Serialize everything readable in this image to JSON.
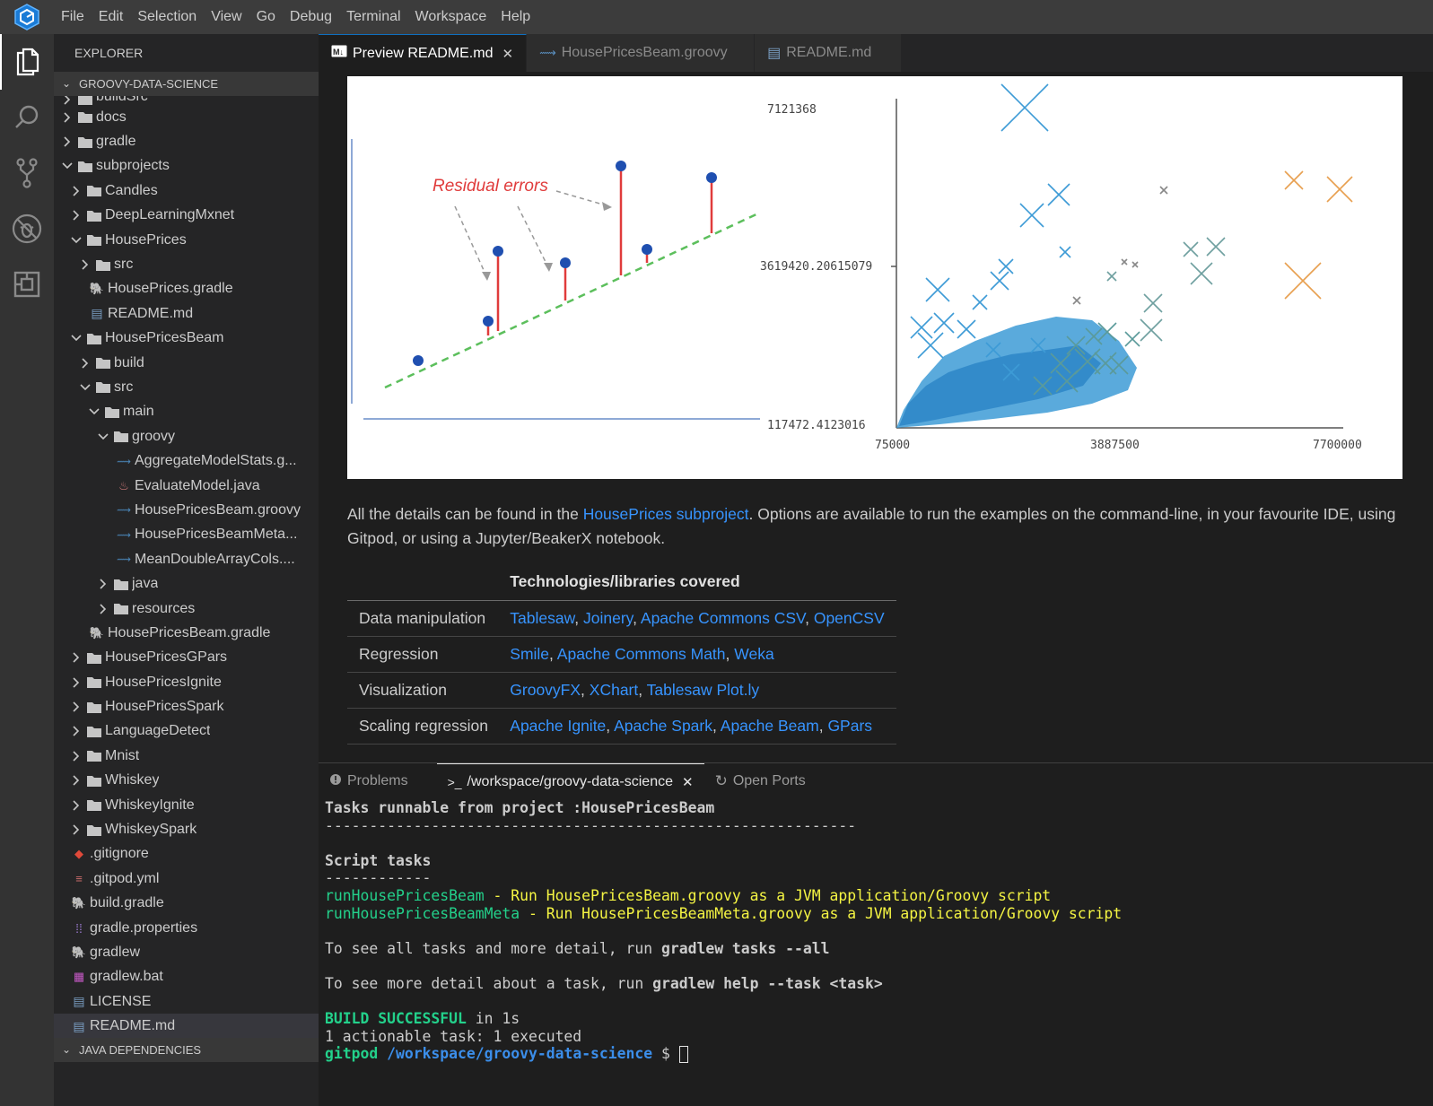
{
  "menubar": {
    "items": [
      "File",
      "Edit",
      "Selection",
      "View",
      "Go",
      "Debug",
      "Terminal",
      "Workspace",
      "Help"
    ]
  },
  "activity_bar": {
    "icons": [
      "files-icon",
      "search-icon",
      "source-control-icon",
      "debug-icon",
      "extensions-icon"
    ]
  },
  "sidebar": {
    "title": "EXPLORER",
    "project_section": "GROOVY-DATA-SCIENCE",
    "dependencies_section": "JAVA DEPENDENCIES",
    "tree": [
      {
        "label": "buildSrc",
        "depth": 0,
        "type": "folder",
        "state": "closed"
      },
      {
        "label": "docs",
        "depth": 0,
        "type": "folder",
        "state": "closed"
      },
      {
        "label": "gradle",
        "depth": 0,
        "type": "folder",
        "state": "closed"
      },
      {
        "label": "subprojects",
        "depth": 0,
        "type": "folder",
        "state": "open"
      },
      {
        "label": "Candles",
        "depth": 1,
        "type": "folder",
        "state": "closed"
      },
      {
        "label": "DeepLearningMxnet",
        "depth": 1,
        "type": "folder",
        "state": "closed"
      },
      {
        "label": "HousePrices",
        "depth": 1,
        "type": "folder",
        "state": "open"
      },
      {
        "label": "src",
        "depth": 2,
        "type": "folder",
        "state": "closed"
      },
      {
        "label": "HousePrices.gradle",
        "depth": 2,
        "type": "gradle"
      },
      {
        "label": "README.md",
        "depth": 2,
        "type": "md"
      },
      {
        "label": "HousePricesBeam",
        "depth": 1,
        "type": "folder",
        "state": "open"
      },
      {
        "label": "build",
        "depth": 2,
        "type": "folder",
        "state": "closed"
      },
      {
        "label": "src",
        "depth": 2,
        "type": "folder",
        "state": "open"
      },
      {
        "label": "main",
        "depth": 3,
        "type": "folder",
        "state": "open"
      },
      {
        "label": "groovy",
        "depth": 4,
        "type": "folder",
        "state": "open"
      },
      {
        "label": "AggregateModelStats.g...",
        "depth": 5,
        "type": "groovy"
      },
      {
        "label": "EvaluateModel.java",
        "depth": 5,
        "type": "java"
      },
      {
        "label": "HousePricesBeam.groovy",
        "depth": 5,
        "type": "groovy"
      },
      {
        "label": "HousePricesBeamMeta...",
        "depth": 5,
        "type": "groovy"
      },
      {
        "label": "MeanDoubleArrayCols....",
        "depth": 5,
        "type": "groovy"
      },
      {
        "label": "java",
        "depth": 4,
        "type": "folder",
        "state": "closed"
      },
      {
        "label": "resources",
        "depth": 4,
        "type": "folder",
        "state": "closed"
      },
      {
        "label": "HousePricesBeam.gradle",
        "depth": 2,
        "type": "gradle"
      },
      {
        "label": "HousePricesGPars",
        "depth": 1,
        "type": "folder",
        "state": "closed"
      },
      {
        "label": "HousePricesIgnite",
        "depth": 1,
        "type": "folder",
        "state": "closed"
      },
      {
        "label": "HousePricesSpark",
        "depth": 1,
        "type": "folder",
        "state": "closed"
      },
      {
        "label": "LanguageDetect",
        "depth": 1,
        "type": "folder",
        "state": "closed"
      },
      {
        "label": "Mnist",
        "depth": 1,
        "type": "folder",
        "state": "closed"
      },
      {
        "label": "Whiskey",
        "depth": 1,
        "type": "folder",
        "state": "closed"
      },
      {
        "label": "WhiskeyIgnite",
        "depth": 1,
        "type": "folder",
        "state": "closed"
      },
      {
        "label": "WhiskeySpark",
        "depth": 1,
        "type": "folder",
        "state": "closed"
      },
      {
        "label": ".gitignore",
        "depth": 0,
        "type": "git"
      },
      {
        "label": ".gitpod.yml",
        "depth": 0,
        "type": "yml"
      },
      {
        "label": "build.gradle",
        "depth": 0,
        "type": "gradle"
      },
      {
        "label": "gradle.properties",
        "depth": 0,
        "type": "properties"
      },
      {
        "label": "gradlew",
        "depth": 0,
        "type": "gradle"
      },
      {
        "label": "gradlew.bat",
        "depth": 0,
        "type": "bat"
      },
      {
        "label": "LICENSE",
        "depth": 0,
        "type": "md"
      },
      {
        "label": "README.md",
        "depth": 0,
        "type": "md",
        "selected": true
      }
    ]
  },
  "tabs": [
    {
      "label": "Preview README.md",
      "icon": "markdown-preview-icon",
      "active": true
    },
    {
      "label": "HousePricesBeam.groovy",
      "icon": "groovy-file-icon",
      "active": false
    },
    {
      "label": "README.md",
      "icon": "markdown-file-icon",
      "active": false
    }
  ],
  "preview": {
    "residual_label": "Residual errors",
    "scatter_axis": {
      "y_top": "7121368",
      "y_mid": "3619420.20615079",
      "y_bottom": "117472.4123016",
      "x_left": "75000",
      "x_mid": "3887500",
      "x_right": "7700000"
    },
    "paragraph": {
      "before": "All the details can be found in the ",
      "link": "HousePrices subproject",
      "after": ". Options are available to run the examples on the command-line, in your favourite IDE, using Gitpod, or using a Jupyter/BeakerX notebook."
    },
    "table": {
      "header": "Technologies/libraries covered",
      "rows": [
        {
          "category": "Data manipulation",
          "libs": [
            "Tablesaw",
            "Joinery",
            "Apache Commons CSV",
            "OpenCSV"
          ]
        },
        {
          "category": "Regression",
          "libs": [
            "Smile",
            "Apache Commons Math",
            "Weka"
          ]
        },
        {
          "category": "Visualization",
          "libs": [
            "GroovyFX",
            "XChart",
            "Tablesaw Plot.ly"
          ]
        },
        {
          "category": "Scaling regression",
          "libs": [
            "Apache Ignite",
            "Apache Spark",
            "Apache Beam",
            "GPars"
          ]
        }
      ]
    }
  },
  "panel": {
    "tabs": [
      {
        "label": "Problems",
        "icon": "problems-icon"
      },
      {
        "label": "/workspace/groovy-data-science",
        "icon": "terminal-icon",
        "active": true
      },
      {
        "label": "Open Ports",
        "icon": "ports-icon"
      }
    ],
    "terminal": {
      "header": "Tasks runnable from project :HousePricesBeam",
      "rule1": "------------------------------------------------------------",
      "script_tasks": "Script tasks",
      "rule2": "------------",
      "task1_name": "runHousePricesBeam",
      "task1_desc": " - Run HousePricesBeam.groovy as a JVM application/Groovy script",
      "task2_name": "runHousePricesBeamMeta",
      "task2_desc": " - Run HousePricesBeamMeta.groovy as a JVM application/Groovy script",
      "hint1_prefix": "To see all tasks and more detail, run ",
      "hint1_cmd": "gradlew tasks --all",
      "hint2_prefix": "To see more detail about a task, run ",
      "hint2_cmd": "gradlew help --task <task>",
      "build_status": "BUILD SUCCESSFUL",
      "build_time": " in 1s",
      "summary": "1 actionable task: 1 executed",
      "prompt_user": "gitpod",
      "prompt_path": "/workspace/groovy-data-science",
      "prompt_symbol": " $ "
    }
  },
  "colors": {
    "accent": "#0e70c0",
    "link": "#3794ff",
    "term_green": "#23d18b",
    "term_yellow": "#f5f543",
    "term_blue": "#3b8eea"
  }
}
